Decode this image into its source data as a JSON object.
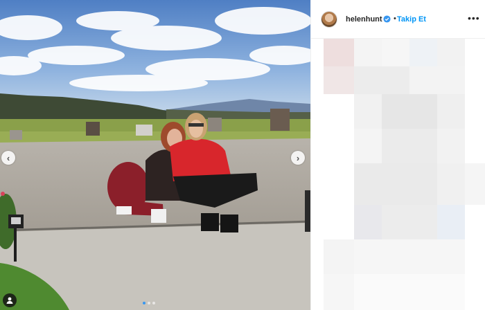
{
  "header": {
    "username": "helenhunt",
    "separator": "•",
    "follow_label": "Takip Et",
    "more_label": "•••"
  },
  "media": {
    "prev_label": "‹",
    "next_label": "›",
    "dot_count": 3,
    "active_dot": 1
  },
  "colors": {
    "accent": "#0095f6",
    "verified_badge": "#3897f0"
  },
  "icons": [
    "chevron-left-icon",
    "chevron-right-icon",
    "verified-badge-icon",
    "more-options-icon",
    "user-tag-icon"
  ]
}
